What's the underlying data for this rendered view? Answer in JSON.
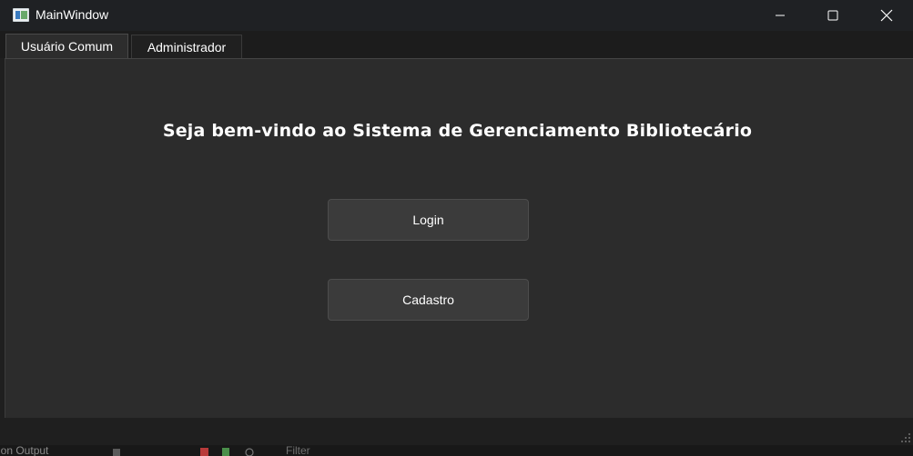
{
  "window": {
    "title": "MainWindow"
  },
  "tabs": [
    {
      "label": "Usuário Comum",
      "active": true
    },
    {
      "label": "Administrador",
      "active": false
    }
  ],
  "main": {
    "welcome": "Seja bem-vindo ao Sistema de Gerenciamento Bibliotecário",
    "login_label": "Login",
    "cadastro_label": "Cadastro"
  },
  "background": {
    "panel_text": "ion Output",
    "filter_text": "Filter"
  },
  "colors": {
    "titlebar": "#1f2124",
    "pane": "#2c2c2c",
    "button": "#3b3b3b",
    "text": "#ffffff"
  }
}
